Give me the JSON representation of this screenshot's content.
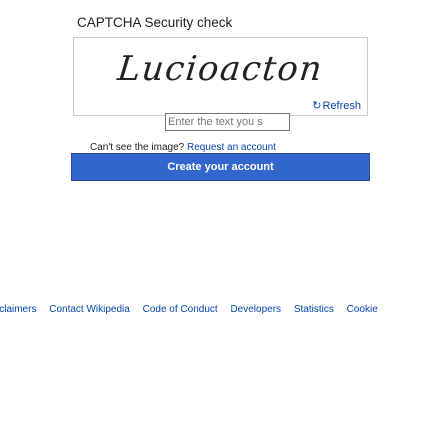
{
  "captcha": {
    "heading": "CAPTCHA Security check",
    "image_text": "Lucioacton",
    "refresh_label": "Refresh",
    "refresh_icon": "refresh-icon",
    "input_placeholder": "Enter the text you s",
    "help_text": "Can't see the image?",
    "help_link": "Request an account"
  },
  "form": {
    "submit_label": "Create your account",
    "submit_color": "#3366cc"
  },
  "footer": {
    "links": [
      "isclaimers",
      "Contact Wikipedia",
      "Code of Conduct",
      "Developers",
      "Statistics",
      "Cookie"
    ]
  },
  "colors": {
    "link": "#0645ad",
    "border": "#c8ccd1",
    "text": "#202122"
  }
}
